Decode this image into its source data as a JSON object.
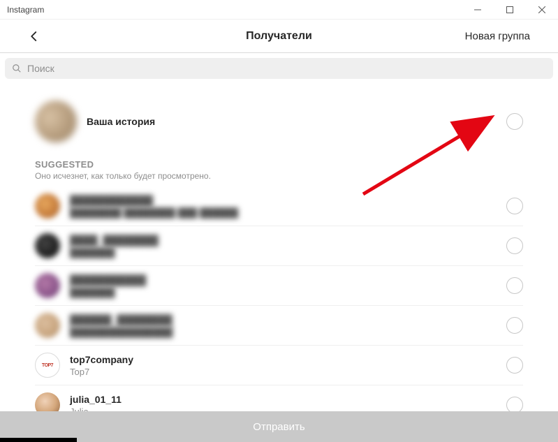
{
  "window": {
    "title": "Instagram"
  },
  "header": {
    "title": "Получатели",
    "new_group": "Новая группа"
  },
  "search": {
    "placeholder": "Поиск"
  },
  "story": {
    "label": "Ваша история"
  },
  "suggested": {
    "title": "SUGGESTED",
    "subtitle": "Оно исчезнет, как только будет просмотрено."
  },
  "users": [
    {
      "name": "████████████",
      "sub": "████████ ████████ ███ ██████",
      "blurred": true,
      "avatar": "av1"
    },
    {
      "name": "████_████████",
      "sub": "███████",
      "blurred": true,
      "avatar": "av2"
    },
    {
      "name": "███████████",
      "sub": "███████",
      "blurred": true,
      "avatar": "av3"
    },
    {
      "name": "██████_████████",
      "sub": "████████████████",
      "blurred": true,
      "avatar": "av4"
    },
    {
      "name": "top7company",
      "sub": "Top7",
      "blurred": false,
      "avatar": "av5",
      "avatar_text": "TOP7"
    },
    {
      "name": "julia_01_11",
      "sub": "Julia",
      "blurred": false,
      "avatar": "av6"
    }
  ],
  "send": {
    "label": "Отправить"
  }
}
